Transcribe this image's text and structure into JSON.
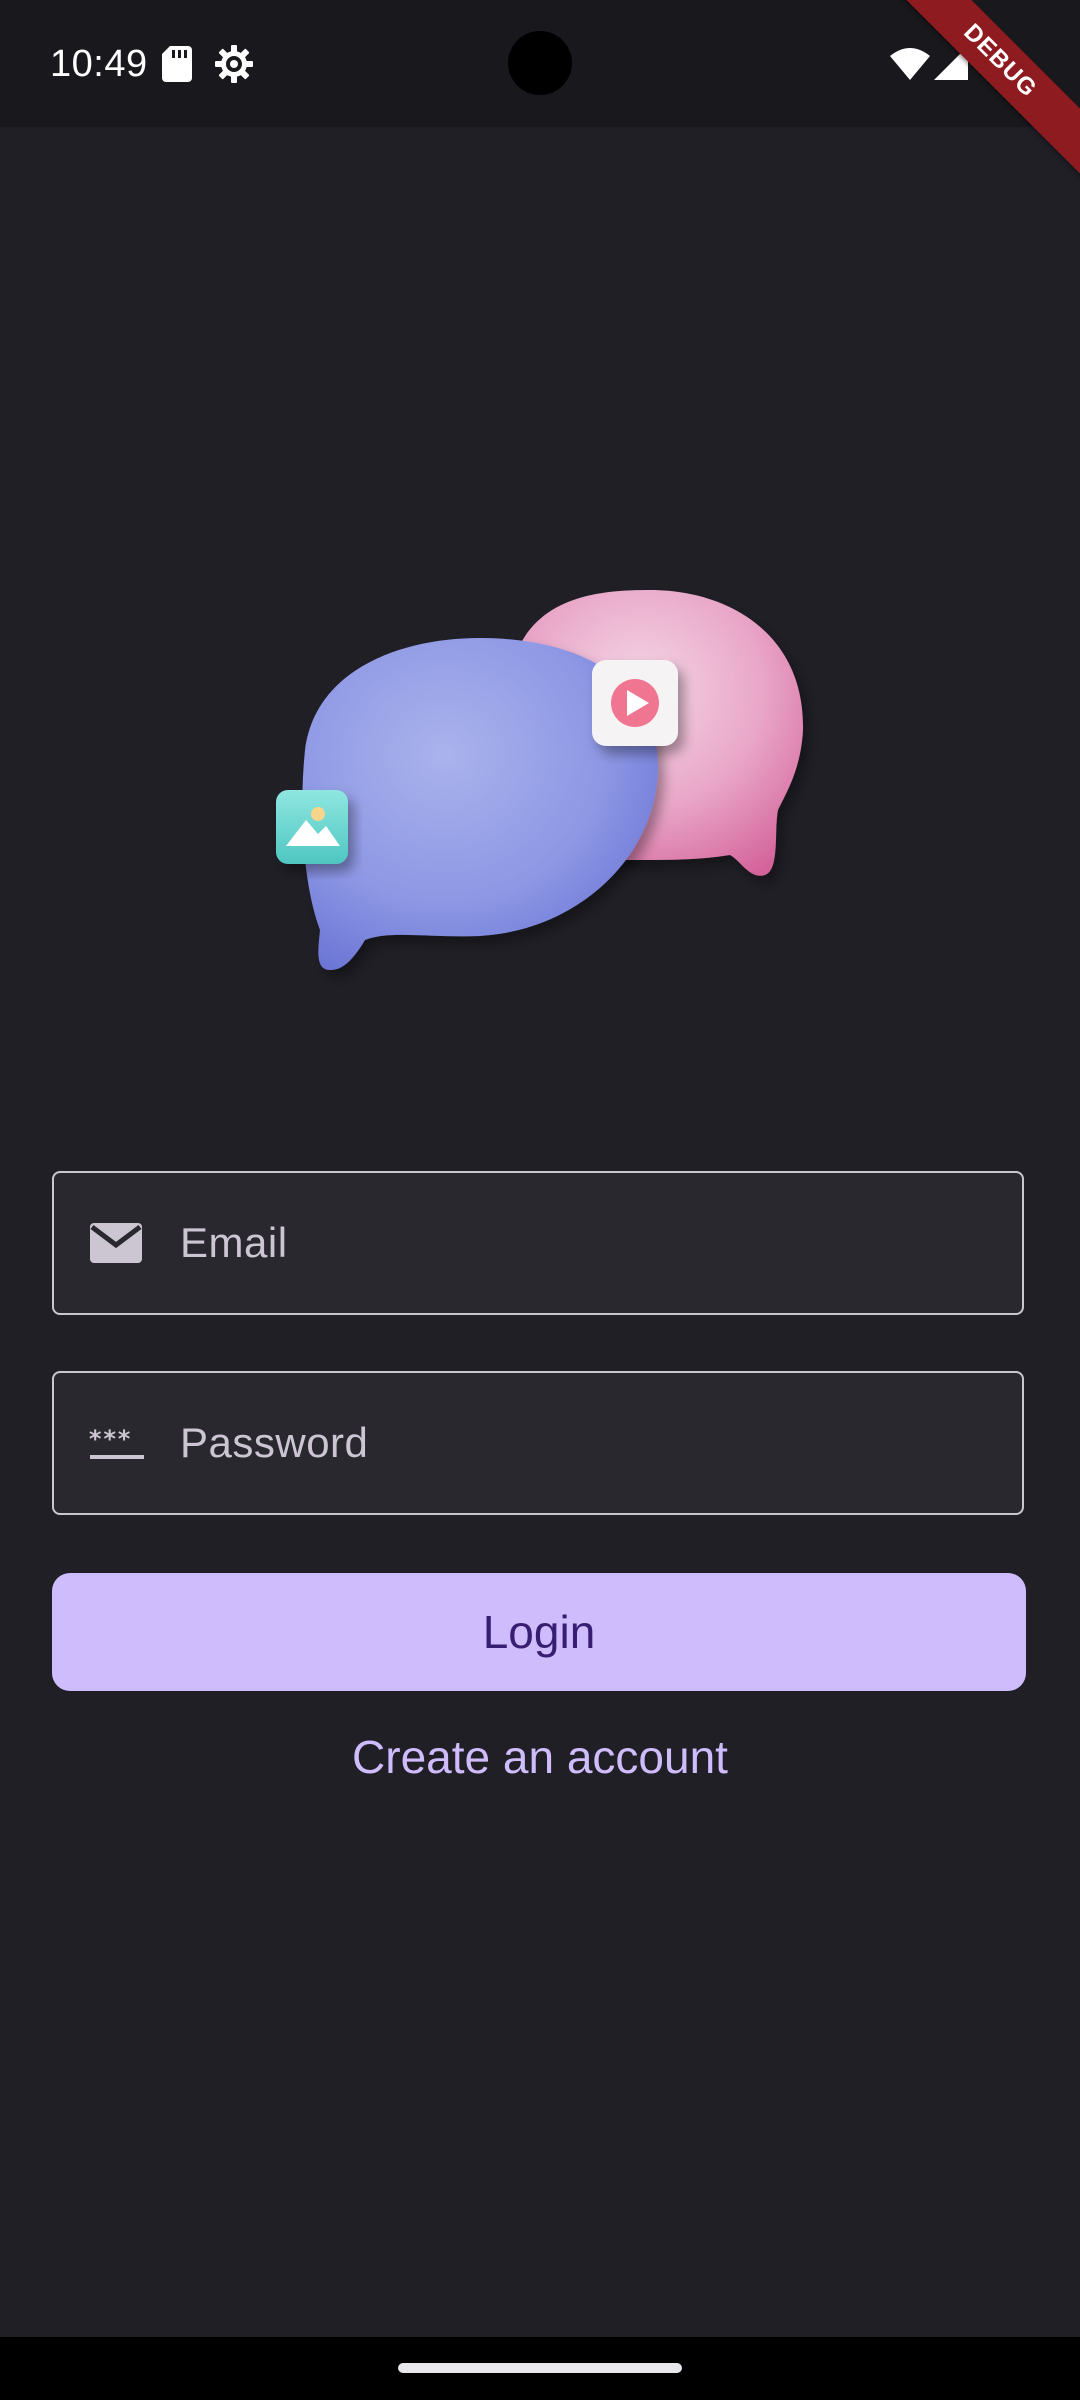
{
  "status_bar": {
    "time": "10:49",
    "icons": [
      "sd-card-icon",
      "settings-gear-icon",
      "wifi-icon",
      "cell-signal-icon"
    ],
    "debug_banner": "DEBUG"
  },
  "illustration": {
    "name": "chat-bubbles-illustration",
    "colors": {
      "blue_bubble": "#8d97e4",
      "pink_bubble": "#e9a6c8",
      "image_tile": "#6ed6d2",
      "play_badge": "#ef7590"
    }
  },
  "form": {
    "email": {
      "placeholder": "Email",
      "icon": "mail-icon"
    },
    "password": {
      "placeholder": "Password",
      "icon": "password-icon"
    },
    "login_label": "Login",
    "create_account_label": "Create an account"
  },
  "theme": {
    "background": "#201f26",
    "accent": "#cfbcfc",
    "button_text": "#381e72"
  }
}
